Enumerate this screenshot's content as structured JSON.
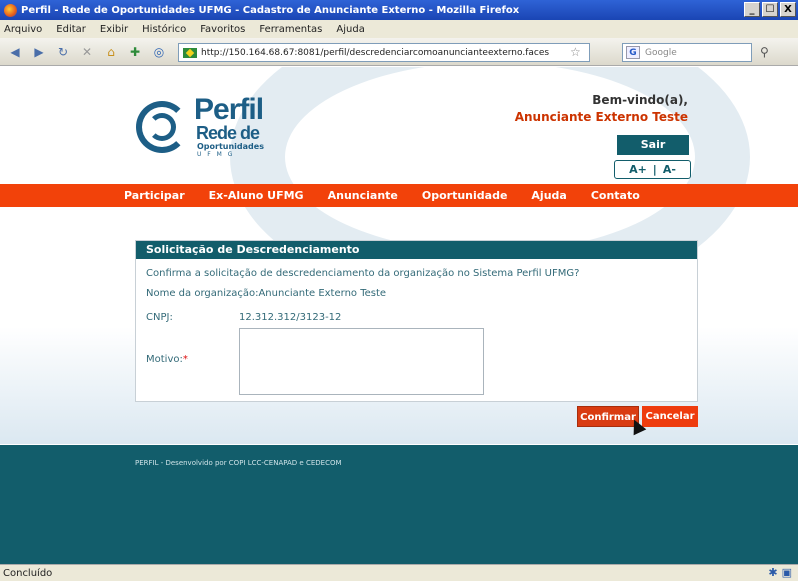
{
  "window": {
    "title": "Perfil - Rede de Oportunidades UFMG - Cadastro de Anunciante Externo - Mozilla Firefox",
    "controls": [
      "_",
      "☐",
      "X"
    ]
  },
  "menubar": {
    "items": [
      "Arquivo",
      "Editar",
      "Exibir",
      "Histórico",
      "Favoritos",
      "Ferramentas",
      "Ajuda"
    ]
  },
  "toolbar": {
    "url": "http://150.164.68.67:8081/perfil/descredenciarcomoanuncianteexterno.faces",
    "search_placeholder": "Google"
  },
  "header": {
    "logo": {
      "line1": "Perfil",
      "line2": "Rede de",
      "line3": "Oportunidades",
      "line4": "U F M G"
    },
    "welcome": "Bem-vindo(a),",
    "user": "Anunciante Externo Teste",
    "logout_label": "Sair",
    "font_increase": "A+",
    "font_sep": "|",
    "font_decrease": "A-"
  },
  "nav": {
    "items": [
      "Participar",
      "Ex-Aluno UFMG",
      "Anunciante",
      "Oportunidade",
      "Ajuda",
      "Contato"
    ]
  },
  "form": {
    "title": "Solicitação de Descredenciamento",
    "question": "Confirma a solicitação de descredenciamento da organização no Sistema Perfil UFMG?",
    "org_label": "Nome da organização:",
    "org_value": "Anunciante Externo Teste",
    "cnpj_label": "CNPJ:",
    "cnpj_value": "12.312.312/3123-12",
    "motivo_label": "Motivo:",
    "required_mark": "*",
    "motivo_value": ""
  },
  "actions": {
    "confirm": "Confirmar",
    "cancel": "Cancelar"
  },
  "footer": {
    "text": "PERFIL - Desenvolvido por COPI LCC-CENAPAD e CEDECOM"
  },
  "statusbar": {
    "text": "Concluído"
  }
}
